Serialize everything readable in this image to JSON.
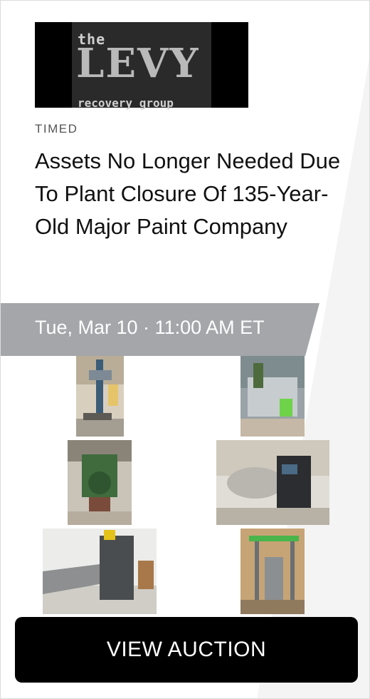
{
  "logo": {
    "line1": "the",
    "line2": "LEVY",
    "line3": "recovery group"
  },
  "auction": {
    "type": "TIMED",
    "title": "Assets No Longer Needed Due To Plant Closure Of 135-Year-Old Major Paint Company",
    "date": "Tue, Mar 10 · 11:00 AM ET"
  },
  "cta": {
    "label": "VIEW AUCTION"
  },
  "thumbnails": [
    {
      "name": "industrial mixer on stand"
    },
    {
      "name": "stainless processing machine"
    },
    {
      "name": "green dispersion mixer"
    },
    {
      "name": "stainless tank with control cabinet"
    },
    {
      "name": "case sealer with roller conveyor"
    },
    {
      "name": "drum lift mixer"
    }
  ],
  "colors": {
    "banner": "#a4a6aa",
    "button": "#000000",
    "text": "#111111"
  }
}
